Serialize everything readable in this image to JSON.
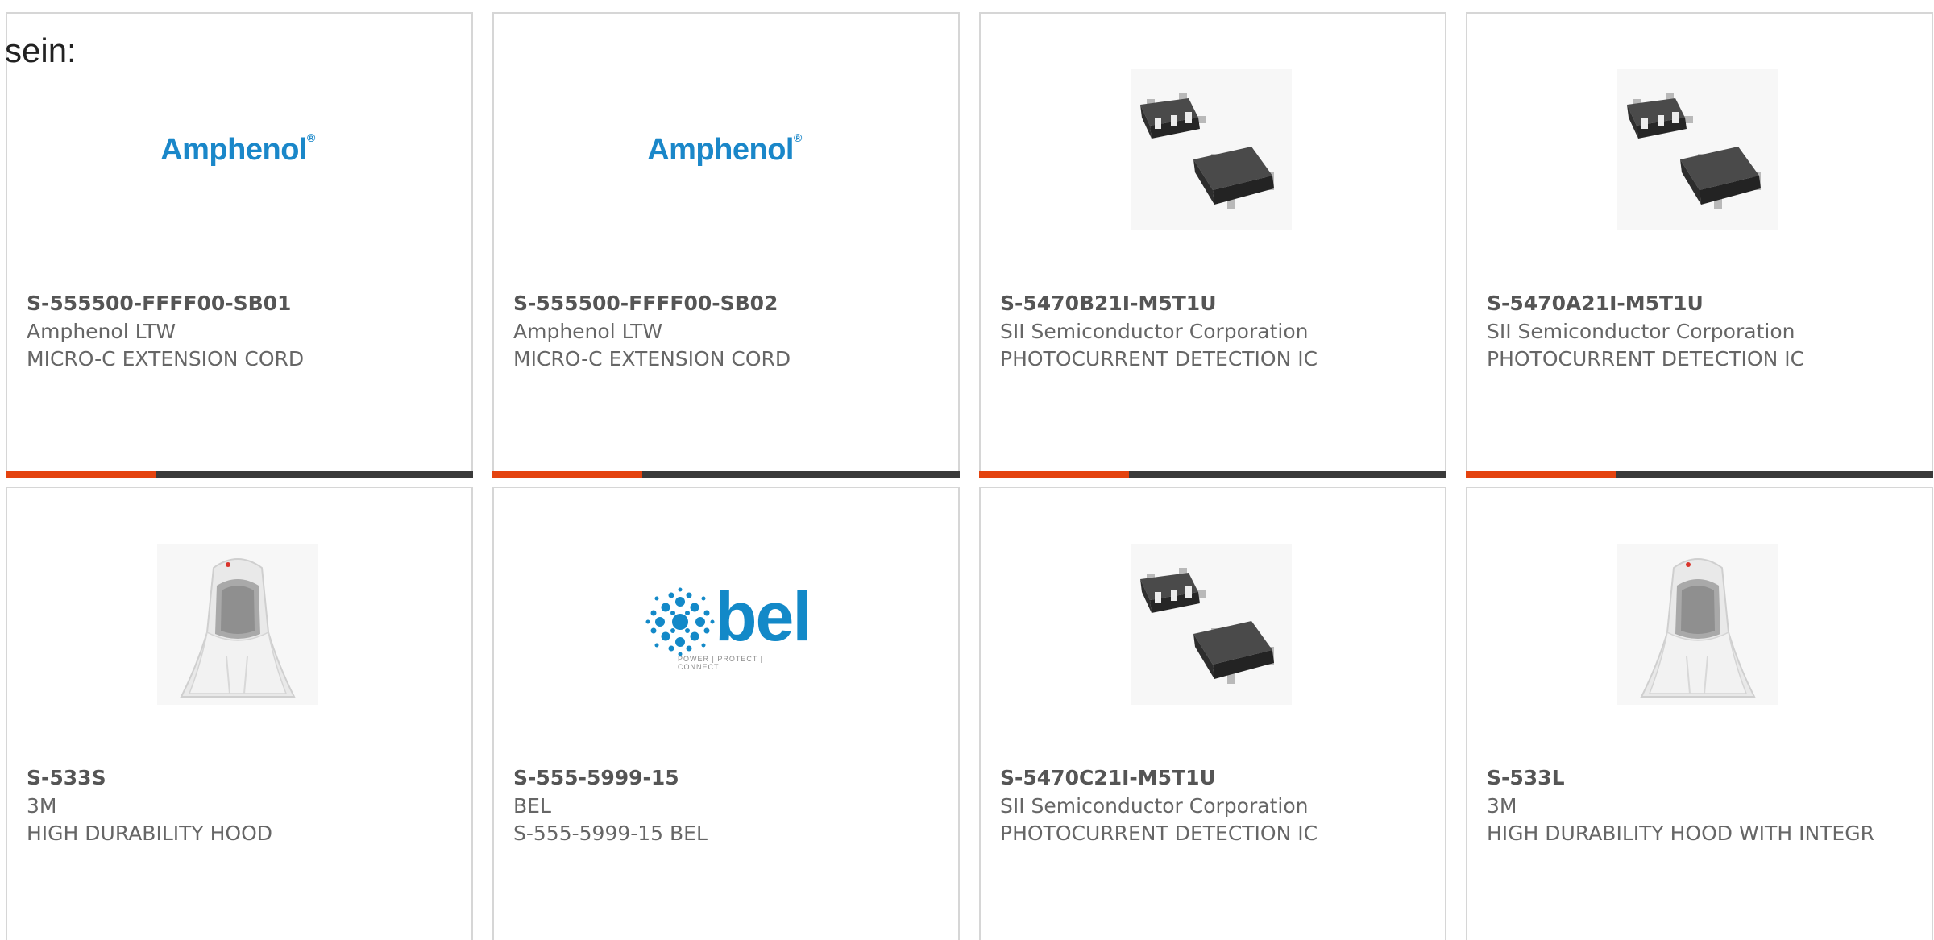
{
  "page": {
    "heading": "sein:"
  },
  "colors": {
    "accent": "#e4430f",
    "bar_track": "#3a3a3a",
    "card_border": "#d6d6d6",
    "text": "#666666",
    "brand_blue": "#1a87c9"
  },
  "cards": [
    {
      "part_number": "S-555500-FFFF00-SB01",
      "manufacturer": "Amphenol LTW",
      "description": "MICRO-C EXTENSION CORD",
      "image": "amphenol-logo",
      "logo_text": "Amphenol",
      "logo_mark": "®",
      "progress": 0.32
    },
    {
      "part_number": "S-555500-FFFF00-SB02",
      "manufacturer": "Amphenol LTW",
      "description": "MICRO-C EXTENSION CORD",
      "image": "amphenol-logo",
      "logo_text": "Amphenol",
      "logo_mark": "®",
      "progress": 0.32
    },
    {
      "part_number": "S-5470B21I-M5T1U",
      "manufacturer": "SII Semiconductor Corporation",
      "description": "PHOTOCURRENT DETECTION IC",
      "image": "sot-chip-photo",
      "progress": 0.32
    },
    {
      "part_number": "S-5470A21I-M5T1U",
      "manufacturer": "SII Semiconductor Corporation",
      "description": "PHOTOCURRENT DETECTION IC",
      "image": "sot-chip-photo",
      "progress": 0.32
    },
    {
      "part_number": "S-533S",
      "manufacturer": "3M",
      "description": "HIGH DURABILITY HOOD",
      "image": "hood-photo"
    },
    {
      "part_number": "S-555-5999-15",
      "manufacturer": "BEL",
      "description": "S-555-5999-15 BEL",
      "image": "bel-logo",
      "logo_text": "bel",
      "logo_tagline": "POWER | PROTECT | CONNECT"
    },
    {
      "part_number": "S-5470C21I-M5T1U",
      "manufacturer": "SII Semiconductor Corporation",
      "description": "PHOTOCURRENT DETECTION IC",
      "image": "sot-chip-photo"
    },
    {
      "part_number": "S-533L",
      "manufacturer": "3M",
      "description": "HIGH DURABILITY HOOD WITH INTEGR",
      "image": "hood-photo"
    }
  ]
}
